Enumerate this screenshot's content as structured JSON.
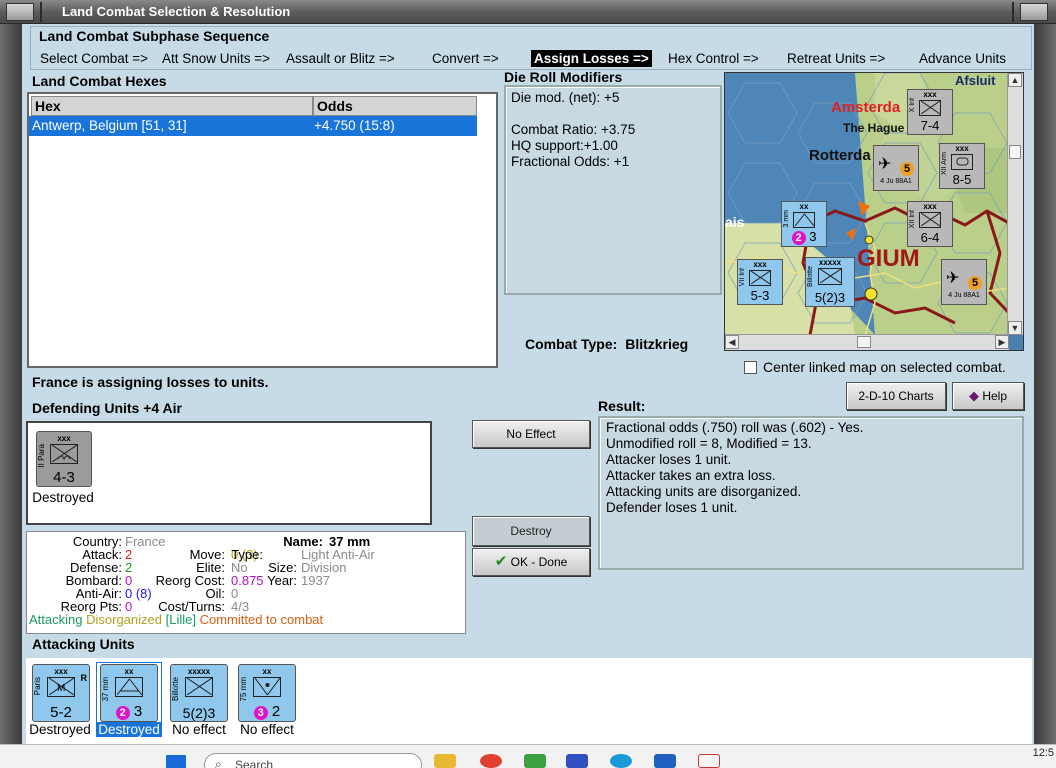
{
  "window": {
    "title": "Land Combat Selection & Resolution"
  },
  "subphase": {
    "header": "Land Combat Subphase Sequence",
    "steps": [
      "Select Combat =>",
      "Att Snow Units =>",
      "Assault or Blitz =>",
      "Convert =>",
      "Assign Losses =>",
      "Hex Control =>",
      "Retreat Units =>",
      "Advance Units"
    ],
    "active_index": 4
  },
  "hexes": {
    "title": "Land Combat Hexes",
    "columns": [
      "Hex",
      "Odds"
    ],
    "rows": [
      {
        "hex": "Antwerp, Belgium [51, 31]",
        "odds": "+4.750 (15:8)"
      }
    ]
  },
  "die_roll": {
    "title": "Die Roll Modifiers",
    "lines": [
      "Die mod. (net): +5",
      "",
      "Combat Ratio: +3.75",
      "HQ support:+1.00",
      "Fractional Odds: +1"
    ]
  },
  "map": {
    "labels": {
      "amsterdam": "Amsterda",
      "hague": "The Hague",
      "rotterdam": "Rotterda",
      "belgium": "GIUM",
      "afsluit": "Afsluit",
      "antwerp": "ais"
    },
    "counters": [
      {
        "size": "xxx",
        "value": "7-4",
        "side": "X Inf"
      },
      {
        "size": "xx",
        "value": "3",
        "side": "3 mm",
        "circle": "2"
      },
      {
        "size": "xxx",
        "value": "6-4",
        "side": "XII Inf"
      },
      {
        "size": "xxx",
        "value": "8-5",
        "side": "XII Arm"
      },
      {
        "size": "xxx",
        "value": "5-3",
        "side": "VII Inf"
      },
      {
        "size": "xxxxx",
        "value": "5(2)3",
        "side": "Billotte"
      },
      {
        "size": "",
        "value": "4 Ju 88A1",
        "side": "",
        "circle": "5"
      },
      {
        "size": "",
        "value": "4 Ju 88A1",
        "side": "",
        "circle": "5"
      }
    ]
  },
  "combat_type": {
    "label": "Combat Type:",
    "value": "Blitzkrieg"
  },
  "center_linked": {
    "label": "Center linked map on selected combat.",
    "checked": false
  },
  "buttons": {
    "charts": "2-D-10 Charts",
    "help": "Help",
    "no_effect": "No Effect",
    "destroy": "Destroy",
    "ok_done": "OK - Done"
  },
  "assign_message": "France is assigning losses to units.",
  "defending": {
    "title": "Defending Units +4 Air",
    "units": [
      {
        "size": "xxx",
        "side": "II Para",
        "value": "4-3",
        "status": "Destroyed"
      }
    ]
  },
  "result": {
    "title": "Result:",
    "lines": [
      "Fractional odds (.750) roll was (.602)  - Yes.",
      "Unmodified roll = 8, Modified = 13.",
      "Attacker loses 1 unit.",
      "Attacker takes an extra loss.",
      "Attacking units are disorganized.",
      "Defender loses 1 unit."
    ]
  },
  "unit_info": {
    "country_label": "Country:",
    "country": "France",
    "attack_label": "Attack:",
    "attack": "2",
    "defense_label": "Defense:",
    "defense": "2",
    "bombard_label": "Bombard:",
    "bombard": "0",
    "antiair_label": "Anti-Air:",
    "antiair": "0 (8)",
    "reorgpts_label": "Reorg Pts:",
    "reorgpts": "0",
    "name_label": "Name:",
    "name": "37 mm",
    "move_label": "Move:",
    "move": "0 (3)",
    "type_label": "Type:",
    "type": "Light Anti-Air",
    "elite_label": "Elite:",
    "elite": "No",
    "size_label": "Size:",
    "size": "Division",
    "reorgcost_label": "Reorg Cost:",
    "reorgcost": "0.875",
    "year_label": "Year:",
    "year": "1937",
    "oil_label": "Oil:",
    "oil": "0",
    "costturns_label": "Cost/Turns:",
    "costturns": "4/3",
    "status_attacking": "Attacking",
    "status_disorganized": "Disorganized",
    "status_location": "[Lille]",
    "status_committed": "Committed to combat"
  },
  "attacking": {
    "title": "Attacking Units",
    "units": [
      {
        "size": "xxx",
        "side": "Paris",
        "value": "5-2",
        "status": "Destroyed",
        "r": "R"
      },
      {
        "size": "xx",
        "side": "37 mm",
        "value": "3",
        "circle": "2",
        "status": "Destroyed",
        "selected": true
      },
      {
        "size": "xxxxx",
        "side": "Billotte",
        "value": "5(2)3",
        "status": "No effect"
      },
      {
        "size": "xx",
        "side": "75 mm",
        "value": "2",
        "circle": "3",
        "status": "No effect"
      }
    ]
  },
  "taskbar": {
    "search_placeholder": "Search",
    "clock": "12:5"
  },
  "colors": {
    "client_bg": "#c7dbe6",
    "selection": "#1874d8",
    "unit_blue": "#8fc8ec",
    "unit_grey": "#9b9b9b",
    "attack_red": "#e02020",
    "defense_green": "#1a9a1a",
    "bombard_purple": "#b012c8",
    "antiair_blue": "#1a1ae0",
    "attacking_green": "#1a9a60",
    "disorganized_olive": "#b0a020",
    "committed_orange": "#d06010"
  }
}
